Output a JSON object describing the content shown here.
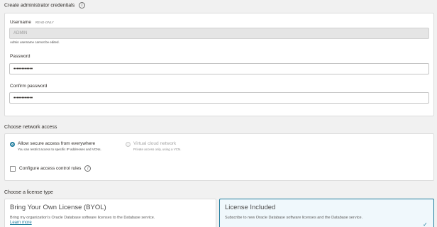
{
  "credentials": {
    "section_title": "Create administrator credentials",
    "username_label": "Username",
    "username_badge": "READ-ONLY",
    "username_value": "ADMIN",
    "username_help": "Admin username cannot be edited.",
    "password_label": "Password",
    "password_value": "••••••••••••",
    "confirm_label": "Confirm password",
    "confirm_value": "••••••••••••"
  },
  "network": {
    "section_title": "Choose network access",
    "option_everywhere": {
      "label": "Allow secure access from everywhere",
      "desc": "You can restrict access to specific IP addresses and VCNs.",
      "selected": true
    },
    "option_vcn": {
      "label": "Virtual cloud network",
      "desc": "Private access only, using a VCN.",
      "selected": false,
      "disabled": true
    },
    "acl_label": "Configure access control rules"
  },
  "license": {
    "section_title": "Choose a license type",
    "byol": {
      "title": "Bring Your Own License (BYOL)",
      "desc": "Bring my organization's Oracle Database software licenses to the Database service.",
      "link": "Learn more"
    },
    "included": {
      "title": "License Included",
      "desc": "Subscribe to new Oracle Database software licenses and the Database service."
    }
  },
  "colors": {
    "accent": "#227e9e",
    "background": "#f1f1f1"
  },
  "icons": {
    "info": "info-icon",
    "check": "check-icon"
  }
}
